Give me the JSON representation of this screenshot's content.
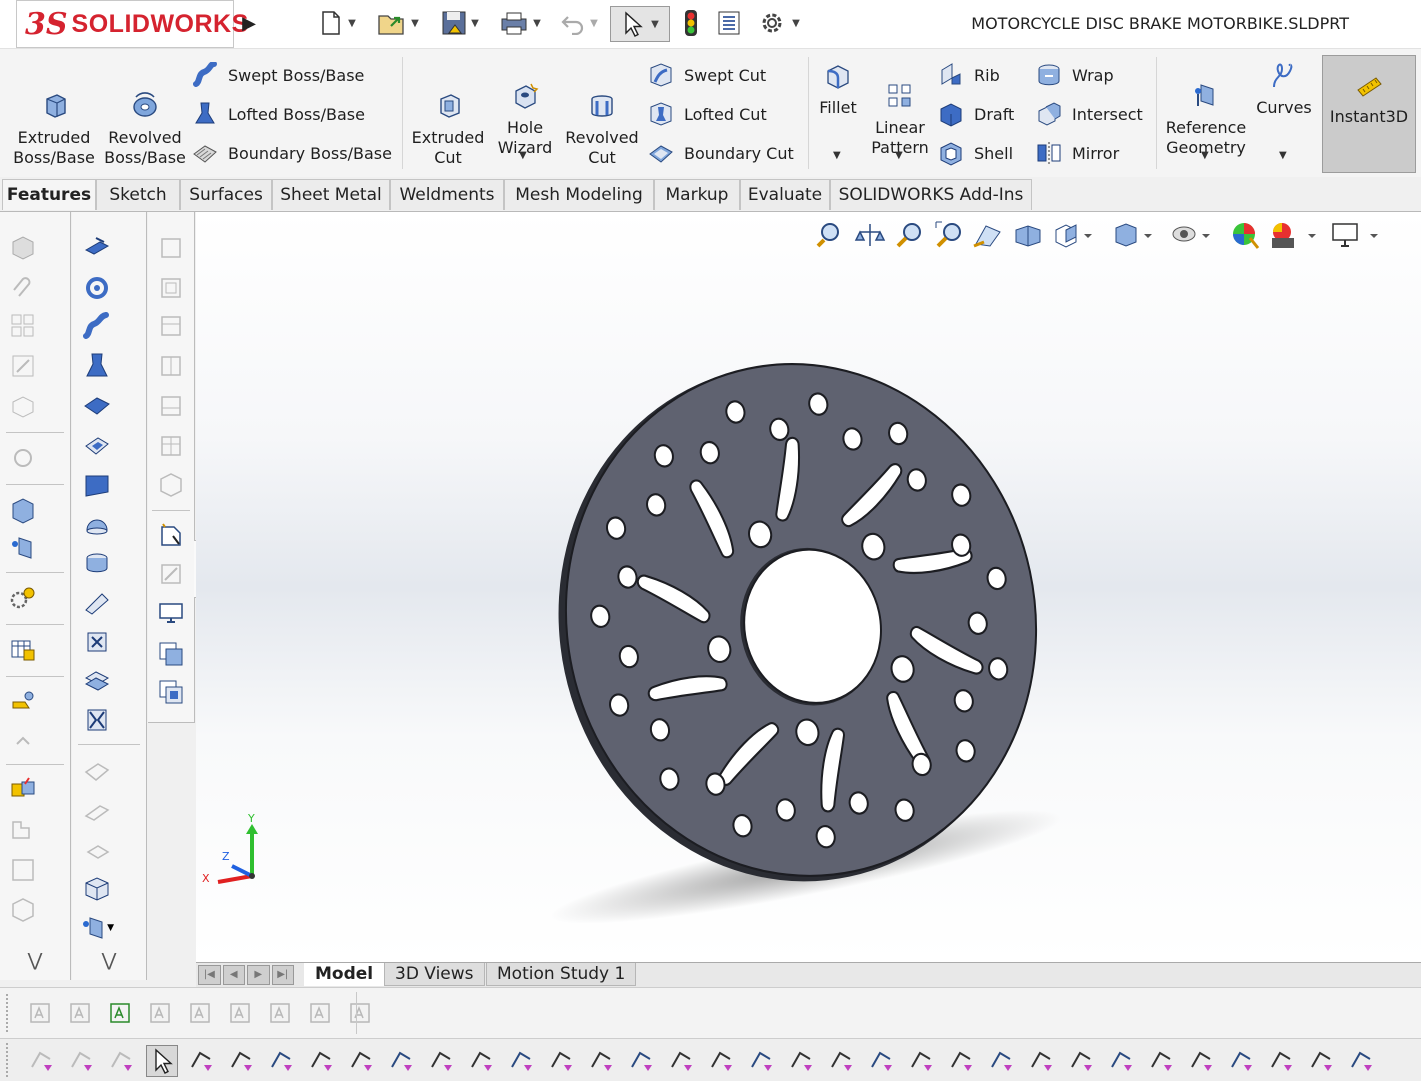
{
  "app": {
    "logo_mark": "3S",
    "logo_name": "SOLIDWORKS",
    "document_title": "MOTORCYCLE DISC BRAKE MOTORBIKE.SLDPRT"
  },
  "ribbon": {
    "extruded_boss": "Extruded\nBoss/Base",
    "revolved_boss": "Revolved\nBoss/Base",
    "swept_boss": "Swept Boss/Base",
    "lofted_boss": "Lofted Boss/Base",
    "boundary_boss": "Boundary Boss/Base",
    "extruded_cut": "Extruded\nCut",
    "hole_wizard": "Hole\nWizard",
    "revolved_cut": "Revolved\nCut",
    "swept_cut": "Swept Cut",
    "lofted_cut": "Lofted Cut",
    "boundary_cut": "Boundary Cut",
    "fillet": "Fillet",
    "linear_pattern": "Linear\nPattern",
    "rib": "Rib",
    "draft": "Draft",
    "shell": "Shell",
    "wrap": "Wrap",
    "intersect": "Intersect",
    "mirror": "Mirror",
    "reference_geometry": "Reference\nGeometry",
    "curves": "Curves",
    "instant3d": "Instant3D"
  },
  "tabs": [
    "Features",
    "Sketch",
    "Surfaces",
    "Sheet Metal",
    "Weldments",
    "Mesh Modeling",
    "Markup",
    "Evaluate",
    "SOLIDWORKS Add-Ins"
  ],
  "active_tab": "Features",
  "bottom_tabs": [
    "Model",
    "3D Views",
    "Motion Study 1"
  ],
  "active_bottom_tab": "Model",
  "triad": {
    "x": "X",
    "y": "Y",
    "z": "Z"
  },
  "colors": {
    "disc_face": "#5f6270",
    "disc_edge": "#2a2c33",
    "brand_red": "#d5232f",
    "axis_x": "#e02020",
    "axis_y": "#2fbf2f",
    "axis_z": "#2060e0"
  }
}
